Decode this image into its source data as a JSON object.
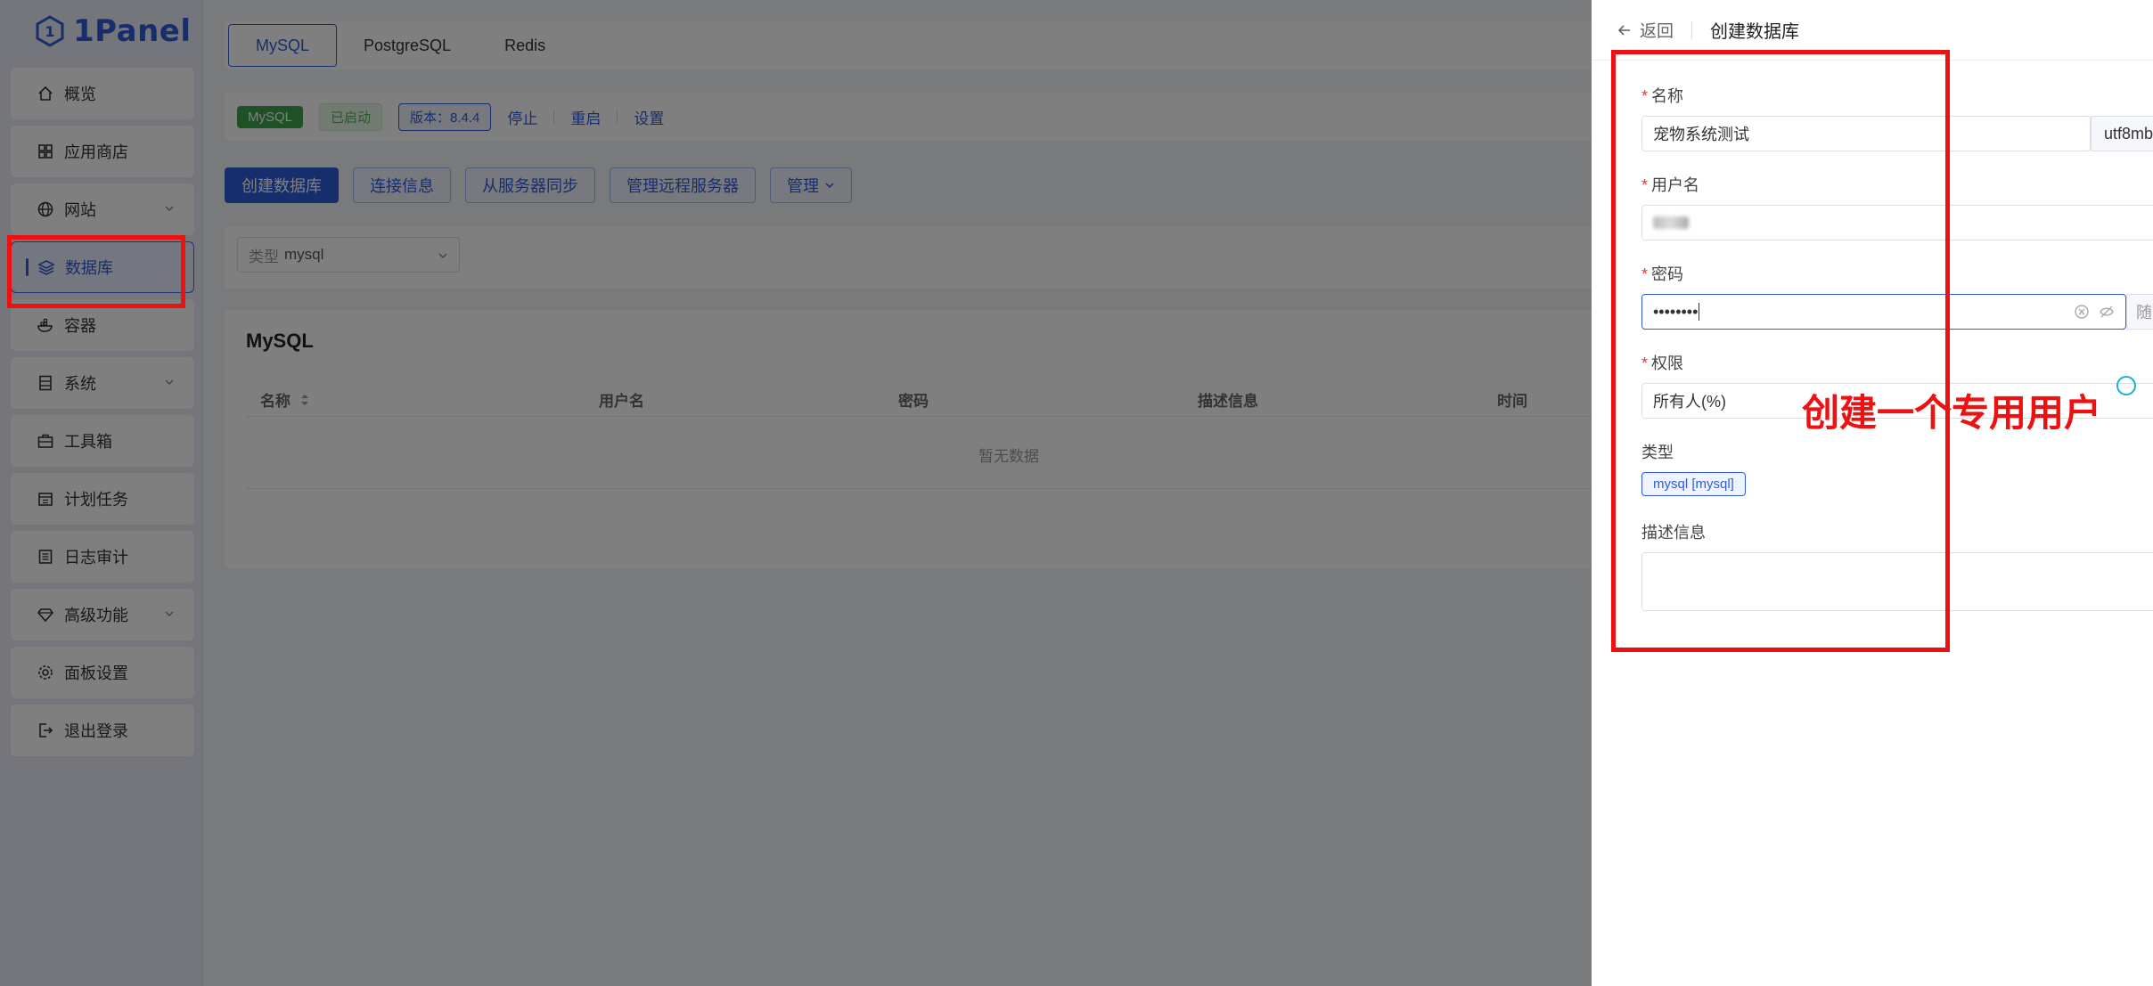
{
  "app": {
    "logo_text": "1Panel"
  },
  "sidebar": {
    "items": [
      {
        "label": "概览",
        "icon": "home-icon"
      },
      {
        "label": "应用商店",
        "icon": "grid-icon"
      },
      {
        "label": "网站",
        "icon": "globe-icon",
        "expandable": true
      },
      {
        "label": "数据库",
        "icon": "layers-icon",
        "active": true
      },
      {
        "label": "容器",
        "icon": "docker-icon"
      },
      {
        "label": "系统",
        "icon": "server-icon",
        "expandable": true
      },
      {
        "label": "工具箱",
        "icon": "toolbox-icon"
      },
      {
        "label": "计划任务",
        "icon": "calendar-icon"
      },
      {
        "label": "日志审计",
        "icon": "log-icon"
      },
      {
        "label": "高级功能",
        "icon": "diamond-icon",
        "expandable": true
      },
      {
        "label": "面板设置",
        "icon": "gear-icon"
      },
      {
        "label": "退出登录",
        "icon": "logout-icon"
      }
    ]
  },
  "tabs": [
    {
      "label": "MySQL",
      "selected": true
    },
    {
      "label": "PostgreSQL"
    },
    {
      "label": "Redis"
    }
  ],
  "status": {
    "app_tag": "MySQL",
    "state_tag": "已启动",
    "version_tag": "版本：8.4.4",
    "stop": "停止",
    "restart": "重启",
    "settings": "设置"
  },
  "actions": {
    "create": "创建数据库",
    "conn_info": "连接信息",
    "sync": "从服务器同步",
    "remote": "管理远程服务器",
    "manage": "管理"
  },
  "filter": {
    "type_prefix": "类型",
    "type_value": "mysql"
  },
  "table": {
    "title": "MySQL",
    "columns": [
      "名称",
      "用户名",
      "密码",
      "描述信息",
      "时间"
    ],
    "empty": "暂无数据"
  },
  "drawer": {
    "back": "返回",
    "title": "创建数据库",
    "name_label": "名称",
    "name_value": "宠物系统测试",
    "charset_value": "utf8mb",
    "username_label": "用户名",
    "password_label": "密码",
    "password_value": "••••••••",
    "password_suffix": "随",
    "permission_label": "权限",
    "permission_value": "所有人(%)",
    "type_label": "类型",
    "type_tag": "mysql [mysql]",
    "desc_label": "描述信息"
  },
  "annotation": {
    "text": "创建一个专用用户",
    "color": "#ee1111"
  },
  "colors": {
    "primary": "#2f5dd8",
    "success": "#3fa34d",
    "danger": "#ee1111"
  }
}
